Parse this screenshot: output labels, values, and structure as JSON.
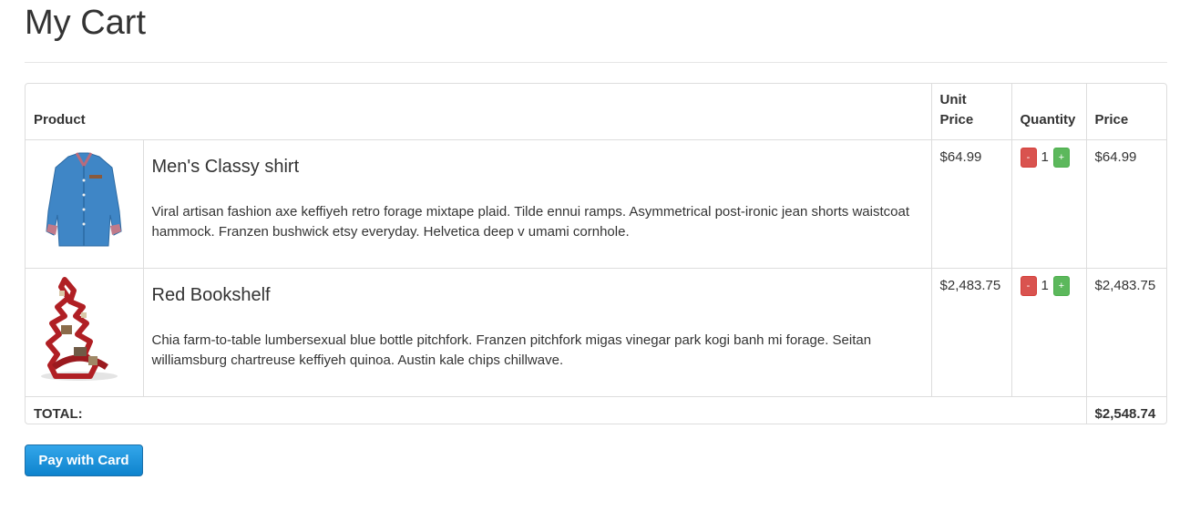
{
  "page": {
    "title": "My Cart"
  },
  "table": {
    "headers": {
      "product": "Product",
      "unit_price": "Unit Price",
      "quantity": "Quantity",
      "price": "Price"
    },
    "items": [
      {
        "name": "Men's Classy shirt",
        "description": "Viral artisan fashion axe keffiyeh retro forage mixtape plaid. Tilde ennui ramps. Asymmetrical post-ironic jean shorts waistcoat hammock. Franzen bushwick etsy everyday. Helvetica deep v umami cornhole.",
        "unit_price": "$64.99",
        "quantity": "1",
        "price": "$64.99",
        "minus_label": "-",
        "plus_label": "+"
      },
      {
        "name": "Red Bookshelf",
        "description": "Chia farm-to-table lumbersexual blue bottle pitchfork. Franzen pitchfork migas vinegar park kogi banh mi forage. Seitan williamsburg chartreuse keffiyeh quinoa. Austin kale chips chillwave.",
        "unit_price": "$2,483.75",
        "quantity": "1",
        "price": "$2,483.75",
        "minus_label": "-",
        "plus_label": "+"
      }
    ],
    "total_label": "TOTAL:",
    "total_value": "$2,548.74"
  },
  "actions": {
    "pay_label": "Pay with Card"
  },
  "colors": {
    "minus": "#d9534f",
    "plus": "#5cb85c",
    "pay": "#1a8fd8"
  }
}
